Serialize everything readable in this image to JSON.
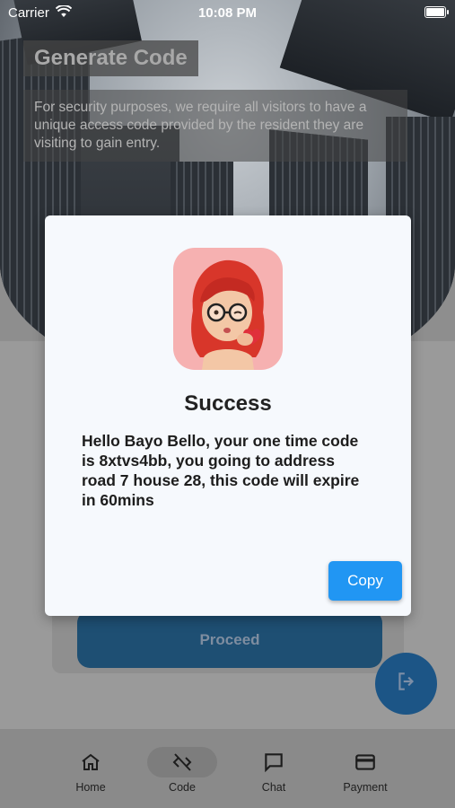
{
  "status_bar": {
    "carrier": "Carrier",
    "time": "10:08 PM"
  },
  "page": {
    "title": "Generate Code",
    "description": "For security purposes, we require all visitors to have a unique access code provided by the resident they are visiting to gain entry.",
    "proceed_label": "Proceed"
  },
  "dialog": {
    "title": "Success",
    "message": "Hello Bayo Bello, your one time code is 8xtvs4bb, you going to address road 7 house 28, this code will expire in 60mins",
    "copy_label": "Copy",
    "avatar_icon": "memoji-avatar"
  },
  "fab": {
    "icon": "logout-icon"
  },
  "nav": {
    "items": [
      {
        "label": "Home",
        "icon": "home-icon"
      },
      {
        "label": "Code",
        "icon": "code-off-icon"
      },
      {
        "label": "Chat",
        "icon": "chat-icon"
      },
      {
        "label": "Payment",
        "icon": "credit-card-icon"
      }
    ],
    "active_index": 1
  },
  "colors": {
    "accent": "#2196f3",
    "proceed_bg": "#1e4f73",
    "fab_bg": "#1c5586",
    "avatar_bg": "#f6b1b1"
  }
}
